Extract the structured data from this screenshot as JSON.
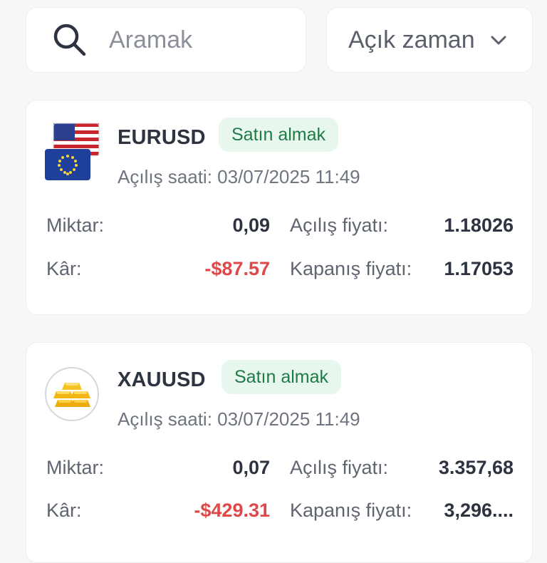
{
  "search": {
    "placeholder": "Aramak",
    "value": ""
  },
  "filter": {
    "label": "Açık zaman"
  },
  "colors": {
    "profit_negative": "#e04848",
    "badge_bg": "#e8f7ee",
    "badge_text": "#1f7a45"
  },
  "positions": [
    {
      "symbol": "EURUSD",
      "icon": "eur-usd-flags-icon",
      "side": "Satın almak",
      "open_time": "Açılış saati: 03/07/2025 11:49",
      "amount_label": "Miktar:",
      "amount": "0,09",
      "open_price_label": "Açılış fiyatı:",
      "open_price": "1.18026",
      "profit_label": "Kâr:",
      "profit": "-$87.57",
      "close_price_label": "Kapanış fiyatı:",
      "close_price": "1.17053"
    },
    {
      "symbol": "XAUUSD",
      "icon": "gold-bars-icon",
      "side": "Satın almak",
      "open_time": "Açılış saati: 03/07/2025 11:49",
      "amount_label": "Miktar:",
      "amount": "0,07",
      "open_price_label": "Açılış fiyatı:",
      "open_price": "3.357,68",
      "profit_label": "Kâr:",
      "profit": "-$429.31",
      "close_price_label": "Kapanış fiyatı:",
      "close_price": "3,296...."
    }
  ]
}
